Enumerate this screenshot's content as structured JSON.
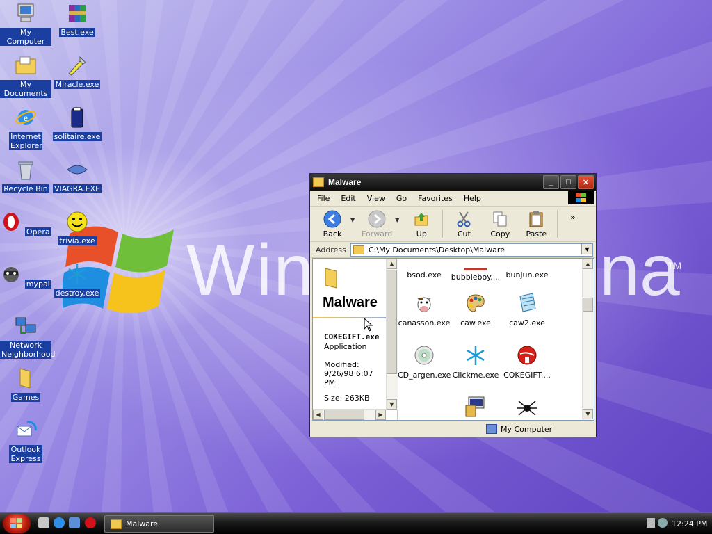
{
  "desktop": {
    "brand_left": "Win",
    "brand_right": "na",
    "brand_tm": "TM",
    "icons": [
      {
        "label": "My Computer",
        "icon": "my-computer-icon"
      },
      {
        "label": "Best.exe",
        "icon": "winrar-icon"
      },
      {
        "label": "My Documents",
        "icon": "my-documents-icon"
      },
      {
        "label": "Miracle.exe",
        "icon": "miracle-icon"
      },
      {
        "label": "Internet Explorer",
        "icon": "internet-explorer-icon"
      },
      {
        "label": "solitaire.exe",
        "icon": "solitaire-icon"
      },
      {
        "label": "Recycle Bin",
        "icon": "recycle-bin-icon"
      },
      {
        "label": "VIAGRA.EXE",
        "icon": "viagra-icon"
      },
      {
        "label": "Opera",
        "icon": "opera-icon"
      },
      {
        "label": "trivia.exe",
        "icon": "smiley-icon"
      },
      {
        "label": "mypal",
        "icon": "mypal-icon"
      },
      {
        "label": "destroy.exe",
        "icon": "snowflake-icon"
      },
      {
        "label": "Network Neighborhood",
        "icon": "network-icon"
      },
      {
        "label": "Games",
        "icon": "folder-icon"
      },
      {
        "label": "Outlook Express",
        "icon": "outlook-express-icon"
      }
    ]
  },
  "window": {
    "title": "Malware",
    "menu": [
      "File",
      "Edit",
      "View",
      "Go",
      "Favorites",
      "Help"
    ],
    "toolbar": {
      "back": "Back",
      "forward": "Forward",
      "up": "Up",
      "cut": "Cut",
      "copy": "Copy",
      "paste": "Paste",
      "more": "»"
    },
    "address": {
      "label": "Address",
      "value": "C:\\My Documents\\Desktop\\Malware"
    },
    "details": {
      "folder_title": "Malware",
      "file_name": "COKEGIFT.exe",
      "file_type": "Application",
      "modified": "Modified: 9/26/98 6:07 PM",
      "size": "Size: 263KB"
    },
    "files": [
      {
        "name": "bsod.exe",
        "icon": "bsod-icon"
      },
      {
        "name": "bubbleboy....",
        "icon": "app-icon"
      },
      {
        "name": "bunjun.exe",
        "icon": "app-icon"
      },
      {
        "name": "canasson.exe",
        "icon": "cow-icon"
      },
      {
        "name": "caw.exe",
        "icon": "paint-palette-icon"
      },
      {
        "name": "caw2.exe",
        "icon": "notepad-icon"
      },
      {
        "name": "CD_argen.exe",
        "icon": "cd-icon"
      },
      {
        "name": "Clickme.exe",
        "icon": "snowflake-icon"
      },
      {
        "name": "COKEGIFT....",
        "icon": "coke-icon"
      },
      {
        "name": "",
        "icon": "installer-icon"
      },
      {
        "name": "",
        "icon": "spider-icon"
      }
    ],
    "status": "My Computer"
  },
  "taskbar": {
    "task_label": "Malware",
    "clock": "12:24 PM"
  },
  "colors": {
    "desktop_label_bg": "#1b3fa0",
    "titlebar": "#0d0d0d",
    "window_bg": "#ece9d8"
  }
}
